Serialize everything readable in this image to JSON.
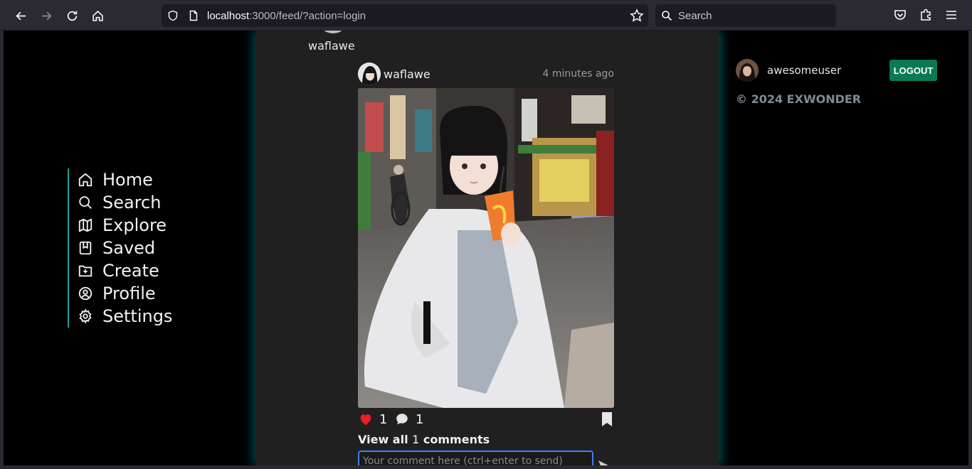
{
  "browser": {
    "url_host": "localhost",
    "url_rest": ":3000/feed/?action=login",
    "search_placeholder": "Search"
  },
  "sidebar": {
    "items": [
      {
        "label": "Home",
        "icon": "home-icon"
      },
      {
        "label": "Search",
        "icon": "search-icon"
      },
      {
        "label": "Explore",
        "icon": "map-icon"
      },
      {
        "label": "Saved",
        "icon": "bookmark-icon"
      },
      {
        "label": "Create",
        "icon": "folder-plus-icon"
      },
      {
        "label": "Profile",
        "icon": "user-circle-icon"
      },
      {
        "label": "Settings",
        "icon": "gear-icon"
      }
    ],
    "accent": "#16a39b"
  },
  "story": {
    "username": "waflawe"
  },
  "post": {
    "username": "waflawe",
    "time": "4 minutes ago",
    "likes": "1",
    "comments": "1",
    "view_all_prefix": "View all",
    "view_all_count": "1",
    "view_all_suffix": "comments",
    "comment_placeholder": "Your comment here (ctrl+enter to send)"
  },
  "account": {
    "username": "awesomeuser",
    "logout_label": "LOGOUT",
    "logout_color": "#0a7a53"
  },
  "footer": {
    "copyright": "© 2024 EXWONDER"
  }
}
